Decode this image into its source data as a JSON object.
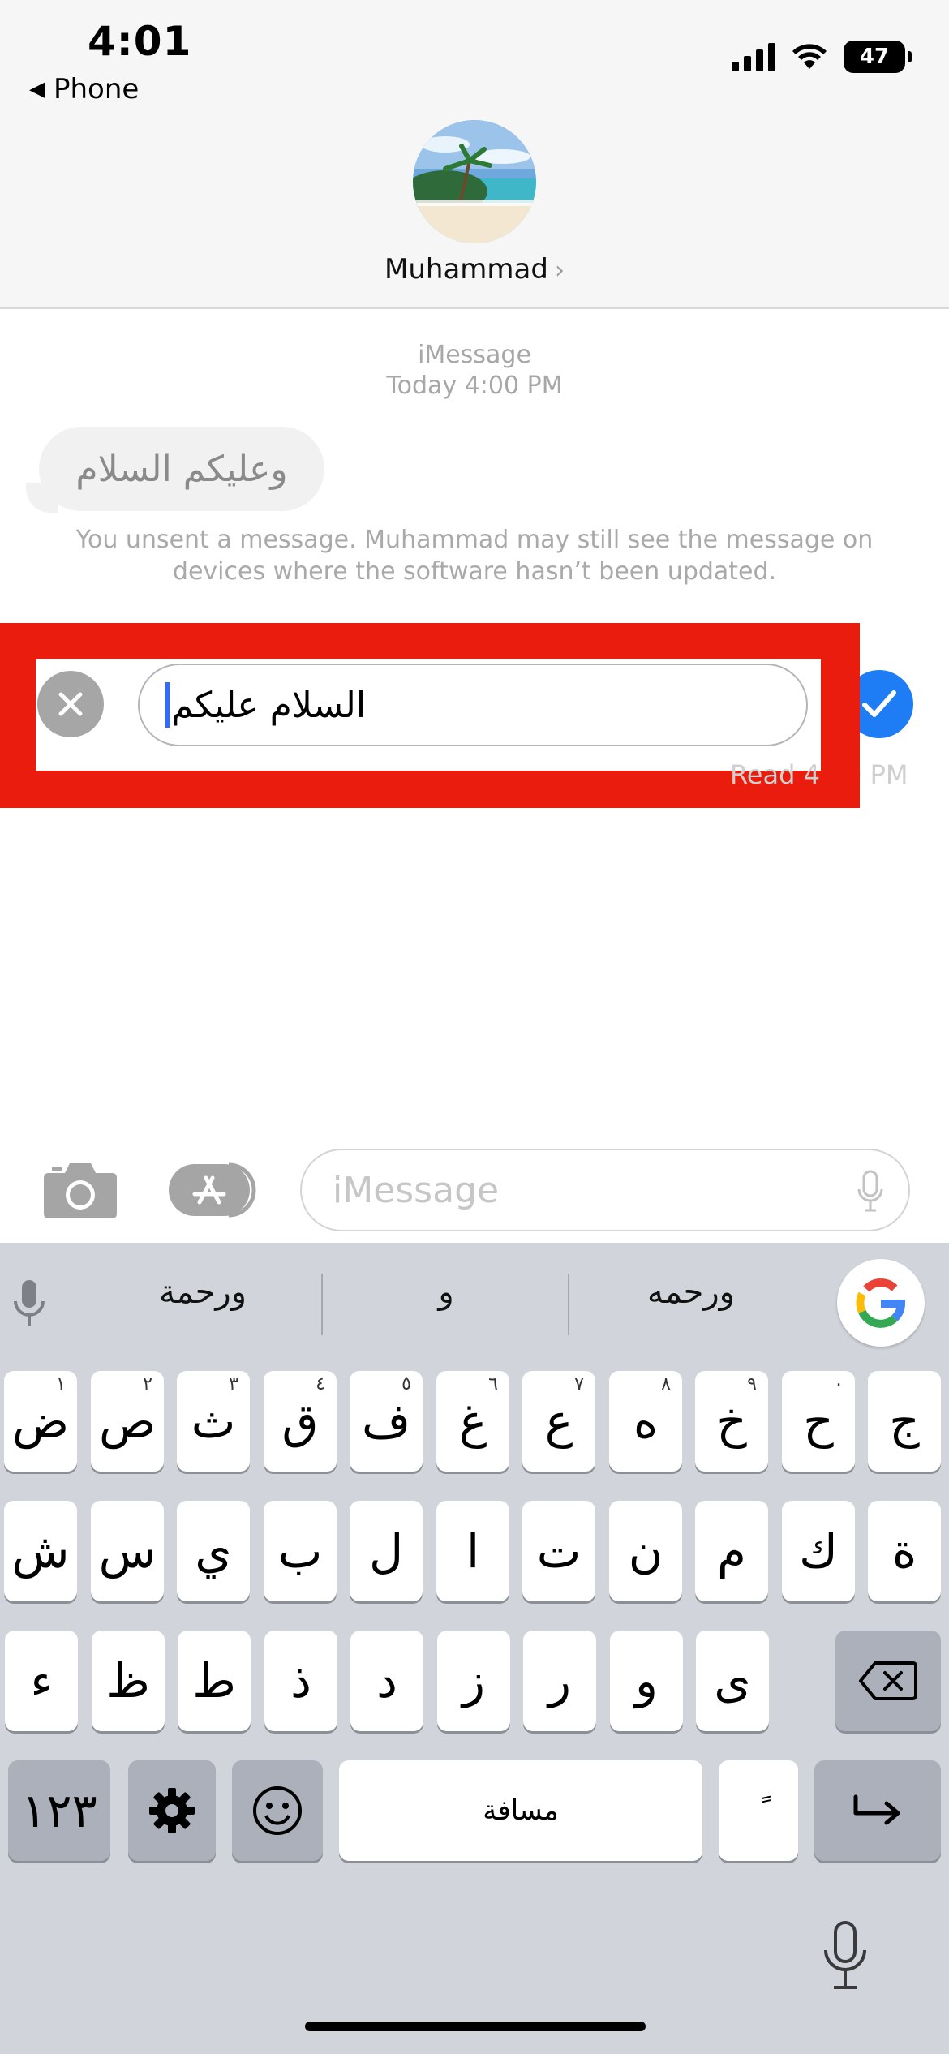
{
  "status_bar": {
    "time": "4:01",
    "back_label": "Phone",
    "battery": "47"
  },
  "header": {
    "contact_name": "Muhammad",
    "chevron": "›",
    "avatar_icon": "beach-photo-avatar"
  },
  "conversation": {
    "service_label": "iMessage",
    "timestamp_label": "Today 4:00 PM",
    "received_message": "وعليكم السلام",
    "unsent_notice": "You unsent a message. Muhammad may still see the message on devices where the software hasn’t been updated.",
    "editing_text": "السلام عليكم",
    "read_label": "Read 4:00 PM",
    "highlight_color": "#ea1c0d",
    "accent_color": "#1e7cf5"
  },
  "input_bar": {
    "placeholder": "iMessage",
    "camera_icon": "camera-icon",
    "apps_icon": "app-store-icon",
    "mic_icon": "microphone-icon"
  },
  "keyboard": {
    "suggestions": [
      "ورحمه",
      "و",
      "ورحمة"
    ],
    "row1": [
      {
        "key": "ج",
        "hint": ""
      },
      {
        "key": "ح",
        "hint": "٠"
      },
      {
        "key": "خ",
        "hint": "٩"
      },
      {
        "key": "ه",
        "hint": "٨"
      },
      {
        "key": "ع",
        "hint": "٧"
      },
      {
        "key": "غ",
        "hint": "٦"
      },
      {
        "key": "ف",
        "hint": "٥"
      },
      {
        "key": "ق",
        "hint": "٤"
      },
      {
        "key": "ث",
        "hint": "٣"
      },
      {
        "key": "ص",
        "hint": "٢"
      },
      {
        "key": "ض",
        "hint": "١"
      }
    ],
    "row2": [
      "ة",
      "ك",
      "م",
      "ن",
      "ت",
      "ا",
      "ل",
      "ب",
      "ي",
      "س",
      "ش"
    ],
    "row3": [
      "ى",
      "و",
      "ر",
      "ز",
      "د",
      "ذ",
      "ط",
      "ظ",
      "ء"
    ],
    "numbers_key": "١٢٣",
    "space_label": "مسافة",
    "diacritic_key": "ً",
    "return_key": "↵"
  }
}
